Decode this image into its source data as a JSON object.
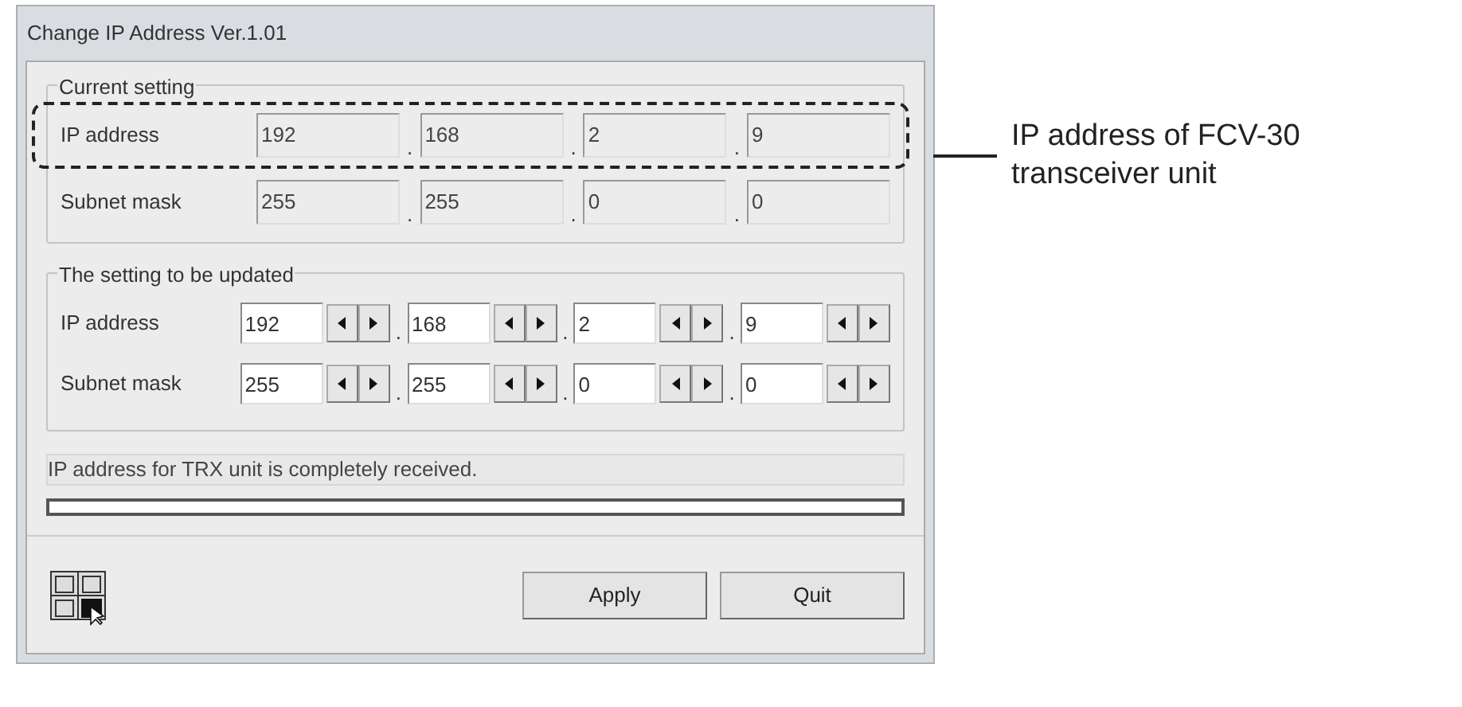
{
  "window": {
    "title": "Change IP Address Ver.1.01"
  },
  "current_setting": {
    "title": "Current setting",
    "rows": [
      {
        "label": "IP address",
        "octets": [
          "192",
          "168",
          "2",
          "9"
        ],
        "highlighted": true
      },
      {
        "label": "Subnet mask",
        "octets": [
          "255",
          "255",
          "0",
          "0"
        ],
        "highlighted": false
      }
    ]
  },
  "updated_setting": {
    "title": "The setting to be updated",
    "rows": [
      {
        "label": "IP address",
        "octets": [
          "192",
          "168",
          "2",
          "9"
        ]
      },
      {
        "label": "Subnet mask",
        "octets": [
          "255",
          "255",
          "0",
          "0"
        ]
      }
    ]
  },
  "separator": ".",
  "status": "IP address for TRX unit is completely received.",
  "progress": {
    "level": 0
  },
  "buttons": [
    "Apply",
    "Quit"
  ],
  "callout": "IP address of FCV-30 transceiver unit"
}
